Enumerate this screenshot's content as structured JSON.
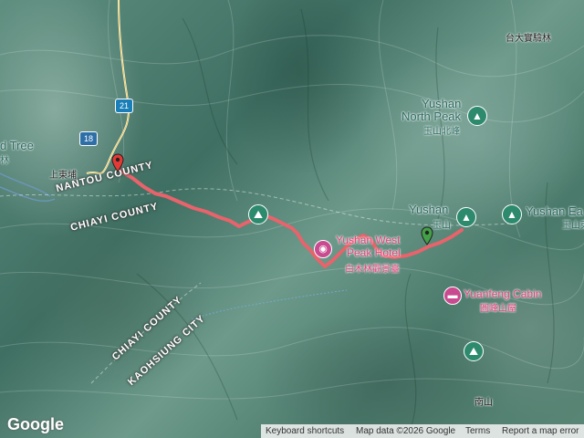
{
  "places": {
    "north_peak_en": "Yushan",
    "north_peak_en2": "North Peak",
    "north_peak_zh": "玉山北峰",
    "main_peak_en": "Yushan",
    "main_peak_zh": "玉山",
    "east_peak_en": "Yushan Ea",
    "east_peak_zh": "玉山東",
    "west_peak_en": "Yushan West",
    "west_peak_en2": "Peak Hotel",
    "west_peak_zh": "白木林觀景臺",
    "cabin_en": "Yuanfeng Cabin",
    "cabin_zh": "圓峰山屋",
    "tree_en": "d Tree",
    "tree_zh": "林",
    "village_zh": "上東埔",
    "forest_zh": "台大實驗林",
    "south_zh": "南山"
  },
  "counties": {
    "nantou": "NANTOU COUNTY",
    "chiayi_upper": "CHIAYI COUNTY",
    "chiayi_lower": "CHIAYI COUNTY",
    "kaohsiung": "KAOHSIUNG CITY"
  },
  "roads": {
    "route_21": "21",
    "route_18": "18"
  },
  "footer": {
    "keyboard": "Keyboard shortcuts",
    "map_data": "Map data ©2026 Google",
    "terms": "Terms",
    "report": "Report a map error"
  },
  "logo": "Google",
  "icons": {
    "peak": "mountain-icon",
    "hiker": "hiker-icon",
    "camera": "camera-icon",
    "lodging": "bed-icon",
    "start": "red-marker-icon",
    "end": "green-marker-icon"
  },
  "colors": {
    "route": "#e8636b",
    "poi": "#2d8a6d",
    "pink_poi": "#c84a8f",
    "route_shield_21": "#1a7fb8",
    "route_shield_18": "#2e6fa8"
  }
}
